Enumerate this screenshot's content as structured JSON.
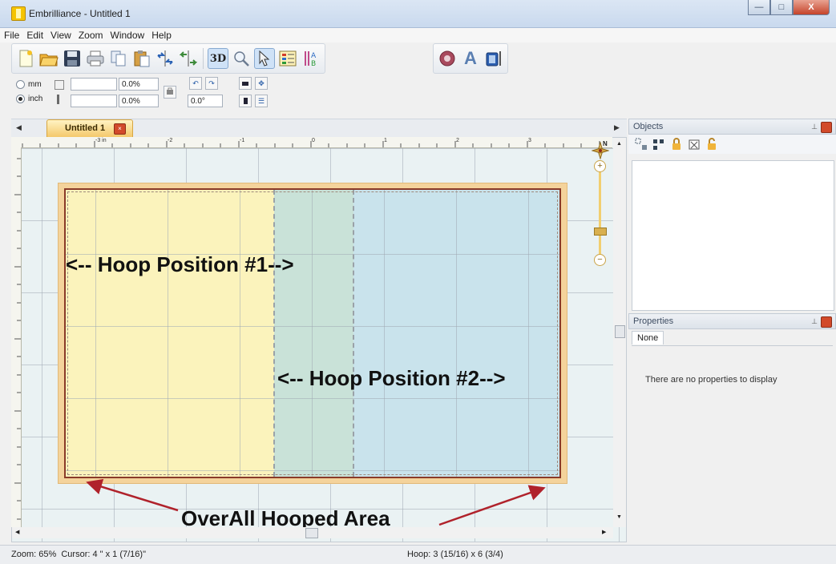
{
  "window": {
    "title": "Embrilliance - Untitled 1",
    "buttons": {
      "minimize": "—",
      "maximize": "□",
      "close": "X"
    }
  },
  "menu": [
    "File",
    "Edit",
    "View",
    "Zoom",
    "Window",
    "Help"
  ],
  "toolbar": {
    "icons": [
      "new-file-icon",
      "open-folder-icon",
      "save-icon",
      "print-icon",
      "copy-icon",
      "paste-icon",
      "mirror-horizontal-icon",
      "mirror-vertical-icon",
      "3d-toggle-icon",
      "magnifier-icon",
      "select-pointer-icon",
      "color-list-icon",
      "stitch-info-icon"
    ],
    "three_d_label": "3D",
    "right_icons": [
      "stitch-player-icon",
      "text-letter-icon",
      "hoop-icon"
    ],
    "accent_letter": "A"
  },
  "options": {
    "unit_mm": "mm",
    "unit_inch": "inch",
    "width_pct": "0.0%",
    "height_pct": "0.0%",
    "rotation": "0.0°"
  },
  "document": {
    "tab_label": "Untitled 1",
    "ruler_top": [
      "-3 in",
      "-2",
      "-1",
      "0",
      "1",
      "2",
      "3"
    ],
    "compass": "N"
  },
  "canvas": {
    "hoop_1_label": "<-- Hoop Position #1-->",
    "hoop_2_label": "<-- Hoop Position #2-->",
    "overall_label": "OverAll Hooped Area",
    "colors": {
      "hoop1_fill": "#fbf3bc",
      "hoop2_fill": "#c9e3ec",
      "overlap_fill": "#c9e2d8",
      "hoop_frame": "#f4d39b",
      "arrow": "#b0222b"
    }
  },
  "objects_panel": {
    "title": "Objects",
    "icons": [
      "group-icon",
      "ungroup-icon",
      "lock-icon",
      "delete-icon",
      "unlock-icon"
    ]
  },
  "properties_panel": {
    "title": "Properties",
    "tab": "None",
    "empty_message": "There are no properties to display"
  },
  "status": {
    "zoom_cursor": "Zoom: 65%  Cursor: 4 \" x 1 (7/16)\"",
    "hoop": "Hoop: 3 (15/16) x 6 (3/4)"
  }
}
